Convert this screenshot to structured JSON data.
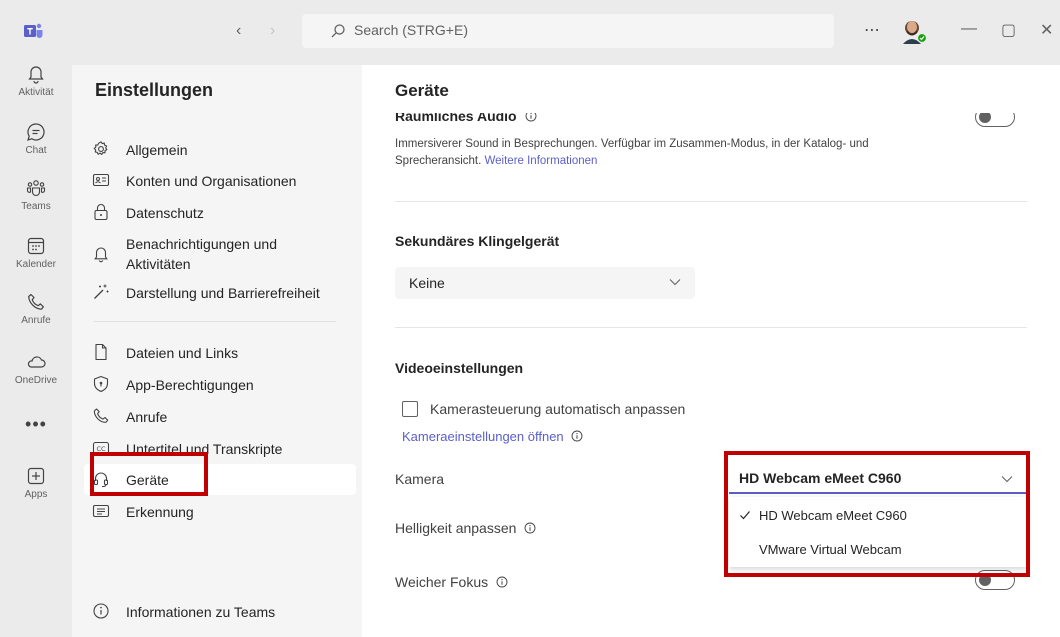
{
  "titlebar": {
    "search_placeholder": "Search (STRG+E)",
    "more_label": "⋯",
    "back_glyph": "‹",
    "forward_glyph": "›",
    "minimize_glyph": "—",
    "maximize_glyph": "▢",
    "close_glyph": "✕"
  },
  "rail": {
    "items": [
      {
        "label": "Aktivität",
        "icon": "bell-icon"
      },
      {
        "label": "Chat",
        "icon": "chat-icon"
      },
      {
        "label": "Teams",
        "icon": "teams-icon"
      },
      {
        "label": "Kalender",
        "icon": "calendar-icon"
      },
      {
        "label": "Anrufe",
        "icon": "phone-icon"
      },
      {
        "label": "OneDrive",
        "icon": "cloud-icon"
      },
      {
        "label": "•••",
        "icon": "more-icon"
      },
      {
        "label": "Apps",
        "icon": "apps-icon"
      }
    ]
  },
  "sidebar": {
    "title": "Einstellungen",
    "items": [
      {
        "label": "Allgemein",
        "icon": "gear-icon"
      },
      {
        "label": "Konten und Organisationen",
        "icon": "contact-card-icon"
      },
      {
        "label": "Datenschutz",
        "icon": "lock-icon"
      },
      {
        "label": "Benachrichtigungen und Aktivitäten",
        "icon": "bell-icon"
      },
      {
        "label": "Darstellung und Barrierefreiheit",
        "icon": "magic-wand-icon"
      },
      {
        "label": "Dateien und Links",
        "icon": "document-icon"
      },
      {
        "label": "App-Berechtigungen",
        "icon": "shield-icon"
      },
      {
        "label": "Anrufe",
        "icon": "phone-icon"
      },
      {
        "label": "Untertitel und Transkripte",
        "icon": "closed-caption-icon"
      },
      {
        "label": "Geräte",
        "icon": "headset-icon",
        "selected": true
      },
      {
        "label": "Erkennung",
        "icon": "recognition-icon"
      },
      {
        "label": "Informationen zu Teams",
        "icon": "info-icon"
      }
    ]
  },
  "content": {
    "title": "Geräte",
    "spatial_audio": {
      "heading": "Räumliches Audio",
      "description": "Immersiverer Sound in Besprechungen. Verfügbar im Zusammen-Modus, in der Katalog- und Sprecheransicht.",
      "link": "Weitere Informationen",
      "toggle_on": false
    },
    "secondary_ringer": {
      "heading": "Sekundäres Klingelgerät",
      "selected": "Keine"
    },
    "video": {
      "heading": "Videoeinstellungen",
      "auto_camera_label": "Kamerasteuerung automatisch anpassen",
      "auto_camera_checked": false,
      "open_camera_settings": "Kameraeinstellungen öffnen",
      "camera_label": "Kamera",
      "camera_selected": "HD Webcam eMeet C960",
      "camera_options": [
        {
          "label": "HD Webcam eMeet C960",
          "checked": true
        },
        {
          "label": "VMware Virtual Webcam",
          "checked": false
        }
      ],
      "brightness_label": "Helligkeit anpassen",
      "soft_focus_label": "Weicher Fokus"
    }
  },
  "colors": {
    "accent": "#5b5fc7",
    "highlight_box": "#c00000",
    "rail_bg": "#ebebeb",
    "sidebar_bg": "#f5f5f5"
  }
}
